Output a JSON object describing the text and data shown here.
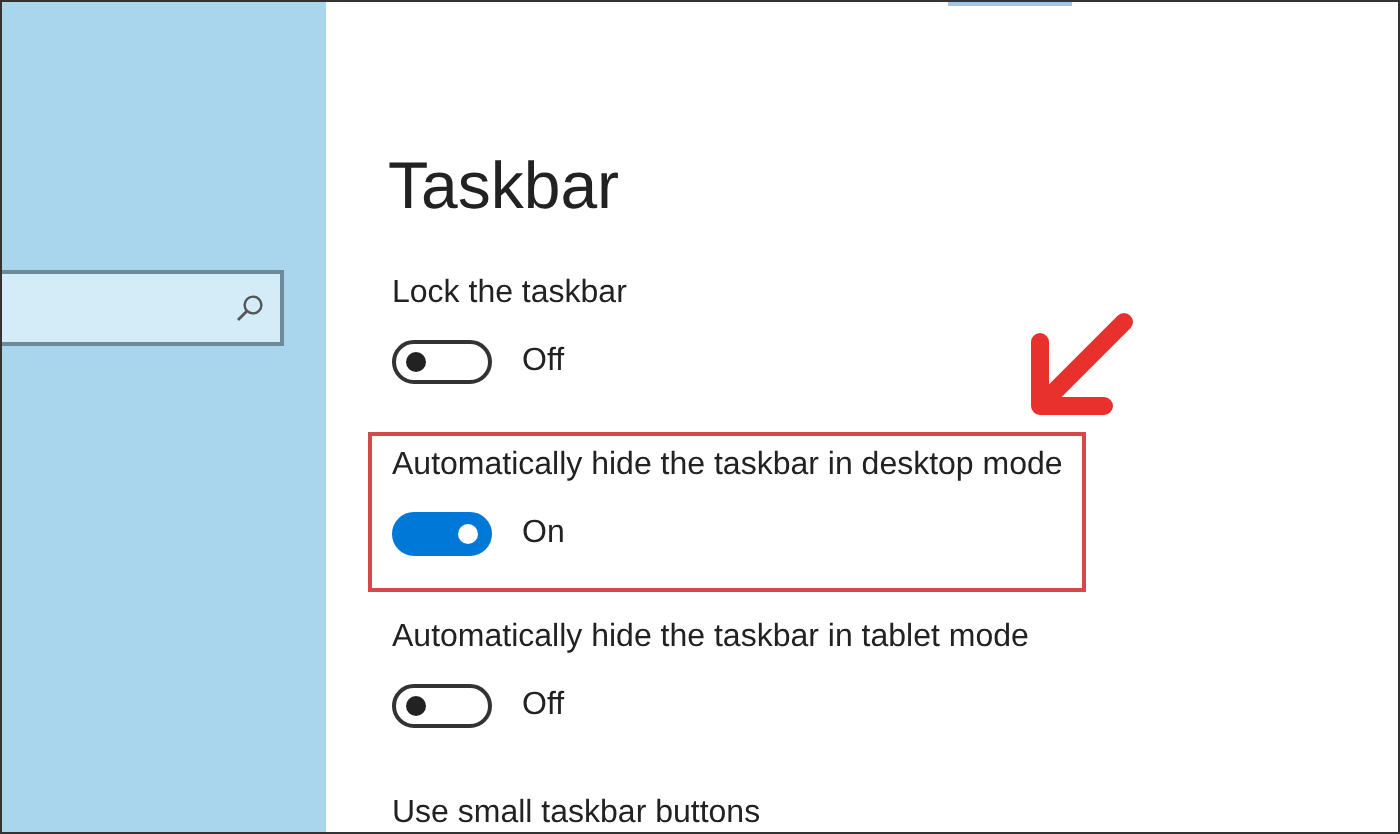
{
  "page": {
    "title": "Taskbar"
  },
  "settings": [
    {
      "label": "Lock the taskbar",
      "on": false,
      "state_text": "Off",
      "highlighted": false
    },
    {
      "label": "Automatically hide the taskbar in desktop mode",
      "on": true,
      "state_text": "On",
      "highlighted": true
    },
    {
      "label": "Automatically hide the taskbar in tablet mode",
      "on": false,
      "state_text": "Off",
      "highlighted": false
    },
    {
      "label": "Use small taskbar buttons",
      "highlighted": false
    }
  ]
}
